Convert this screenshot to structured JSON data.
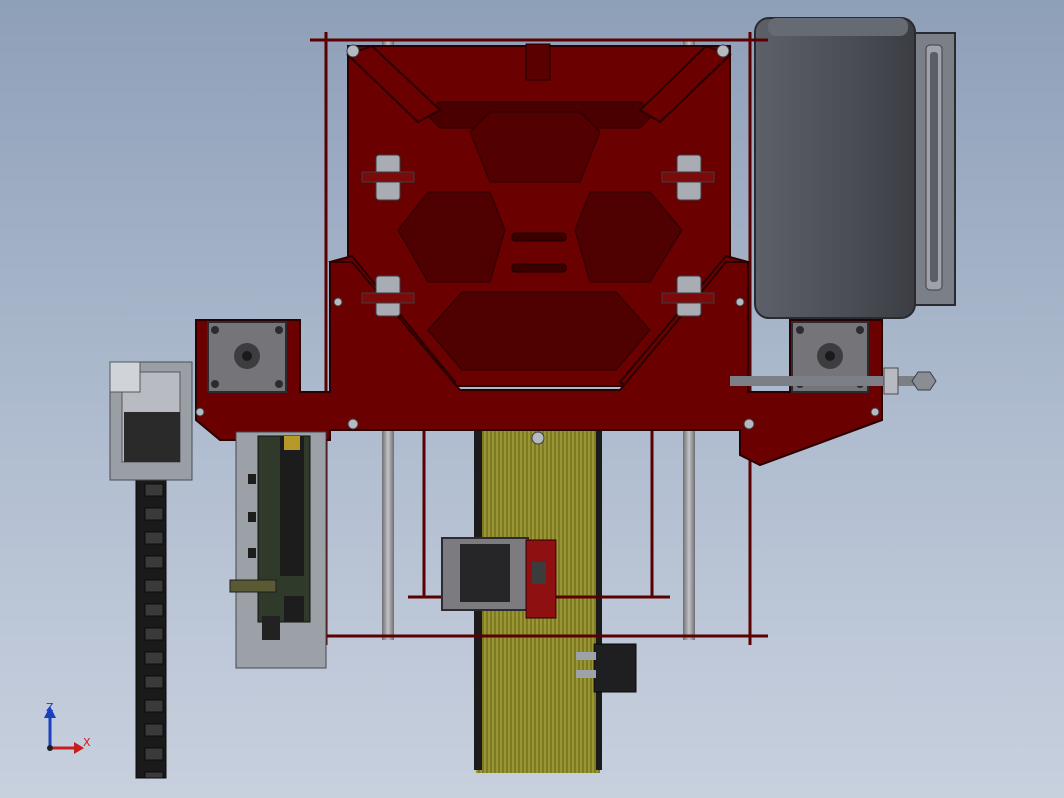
{
  "viewport": {
    "background_top": "#8e9fb8",
    "background_bottom": "#c8d0de"
  },
  "model": {
    "frame_color": "#5a0000",
    "frame_edge": "#2b0000",
    "rod_color": "#8f8f95",
    "motor_color": "#6e6e73",
    "pcb_color": "#2f3a2a",
    "spool_color": "#8c8a2a",
    "chain_color": "#1e1e1e",
    "psu_color": "#4f5258"
  },
  "triad": {
    "z_label": "Z",
    "x_label": "X",
    "z_color": "#1b3fbf",
    "x_color": "#c81e1e"
  }
}
